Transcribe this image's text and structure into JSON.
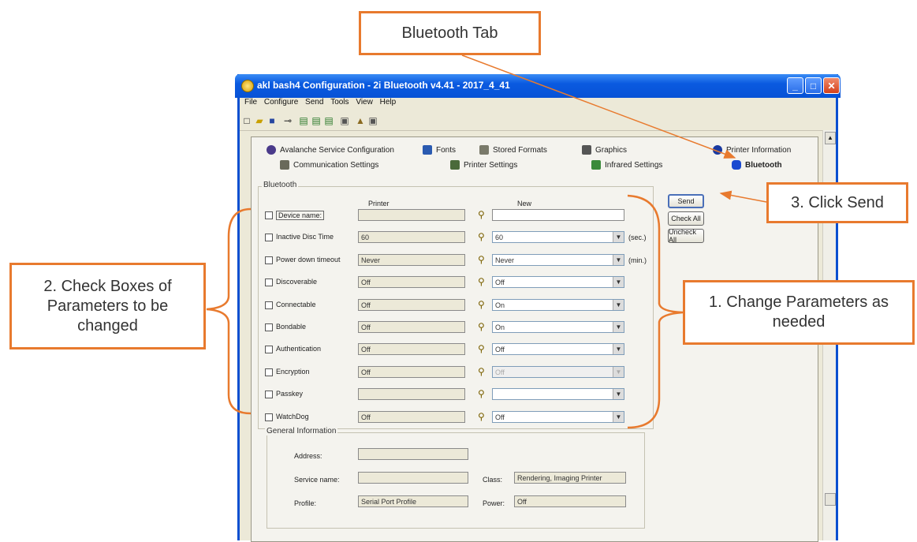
{
  "callouts": {
    "bluetooth_tab": "Bluetooth Tab",
    "click_send": "3. Click Send",
    "check_boxes": "2. Check Boxes of Parameters to be changed",
    "change_params": "1. Change Parameters as needed"
  },
  "window": {
    "title": "akl bash4 Configuration - 2i Bluetooth v4.41 - 2017_4_41",
    "controls": [
      "_",
      "□",
      "✕"
    ]
  },
  "menu": [
    "File",
    "Configure",
    "Send",
    "Tools",
    "View",
    "Help"
  ],
  "tabs_row1": [
    "Avalanche Service Configuration",
    "Fonts",
    "Stored Formats",
    "Graphics",
    "Printer Information"
  ],
  "tabs_row2": [
    "Communication Settings",
    "Printer Settings",
    "Infrared Settings",
    "Bluetooth"
  ],
  "bluetooth_group": {
    "label": "Bluetooth",
    "col_printer": "Printer",
    "col_new": "New",
    "rows": [
      {
        "label": "Device name:",
        "printer": "",
        "new": "",
        "type": "text",
        "unit": ""
      },
      {
        "label": "Inactive Disc Time",
        "printer": "60",
        "new": "60",
        "type": "combo",
        "unit": "(sec.)"
      },
      {
        "label": "Power down timeout",
        "printer": "Never",
        "new": "Never",
        "type": "combo",
        "unit": "(min.)"
      },
      {
        "label": "Discoverable",
        "printer": "Off",
        "new": "Off",
        "type": "combo",
        "unit": ""
      },
      {
        "label": "Connectable",
        "printer": "Off",
        "new": "On",
        "type": "combo",
        "unit": ""
      },
      {
        "label": "Bondable",
        "printer": "Off",
        "new": "On",
        "type": "combo",
        "unit": ""
      },
      {
        "label": "Authentication",
        "printer": "Off",
        "new": "Off",
        "type": "combo",
        "unit": ""
      },
      {
        "label": "Encryption",
        "printer": "Off",
        "new": "Off",
        "type": "combo-disabled",
        "unit": ""
      },
      {
        "label": "Passkey",
        "printer": "",
        "new": "",
        "type": "combo",
        "unit": ""
      },
      {
        "label": "WatchDog",
        "printer": "Off",
        "new": "Off",
        "type": "combo",
        "unit": ""
      }
    ]
  },
  "buttons": {
    "send": "Send",
    "check_all": "Check All",
    "uncheck_all": "Uncheck All"
  },
  "general_info": {
    "label": "General Information",
    "address_label": "Address:",
    "address_value": "",
    "service_name_label": "Service name:",
    "service_name_value": "",
    "class_label": "Class:",
    "class_value": "Rendering, Imaging Printer",
    "profile_label": "Profile:",
    "profile_value": "Serial Port Profile",
    "power_label": "Power:",
    "power_value": "Off"
  },
  "colors": {
    "callout_border": "#e87a2e",
    "titlebar": "#0a5ae0",
    "bracket": "#e87a2e"
  }
}
